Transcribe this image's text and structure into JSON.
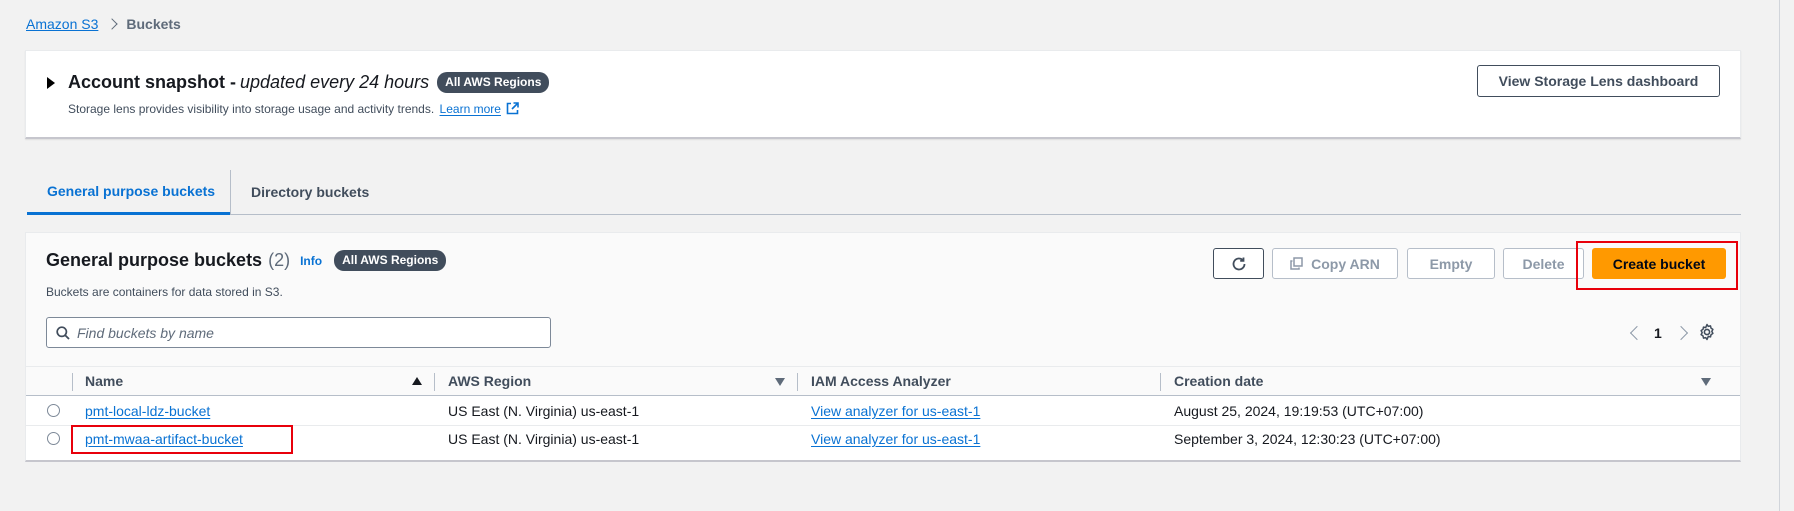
{
  "breadcrumb": {
    "root": "Amazon S3",
    "current": "Buckets"
  },
  "snapshot": {
    "title": "Account snapshot -",
    "subtitle": "updated every 24 hours",
    "badge": "All AWS Regions",
    "description": "Storage lens provides visibility into storage usage and activity trends.",
    "learn_more": "Learn more",
    "lens_button": "View Storage Lens dashboard"
  },
  "tabs": [
    {
      "label": "General purpose buckets",
      "active": true
    },
    {
      "label": "Directory buckets",
      "active": false
    }
  ],
  "buckets_panel": {
    "title": "General purpose buckets",
    "count": "(2)",
    "info": "Info",
    "badge": "All AWS Regions",
    "description": "Buckets are containers for data stored in S3.",
    "actions": {
      "copy_arn": "Copy ARN",
      "empty": "Empty",
      "delete": "Delete",
      "create": "Create bucket"
    },
    "search": {
      "placeholder": "Find buckets by name",
      "value": ""
    },
    "pager": {
      "page": "1"
    },
    "columns": [
      "Name",
      "AWS Region",
      "IAM Access Analyzer",
      "Creation date"
    ],
    "rows": [
      {
        "name": "pmt-local-ldz-bucket",
        "region": "US East (N. Virginia) us-east-1",
        "analyzer": "View analyzer for us-east-1",
        "created": "August 25, 2024, 19:19:53 (UTC+07:00)"
      },
      {
        "name": "pmt-mwaa-artifact-bucket",
        "region": "US East (N. Virginia) us-east-1",
        "analyzer": "View analyzer for us-east-1",
        "created": "September 3, 2024, 12:30:23 (UTC+07:00)"
      }
    ]
  },
  "colors": {
    "link": "#0972d3",
    "primary_button": "#ff9900",
    "highlight": "#e8000b",
    "badge": "#414d5c"
  }
}
